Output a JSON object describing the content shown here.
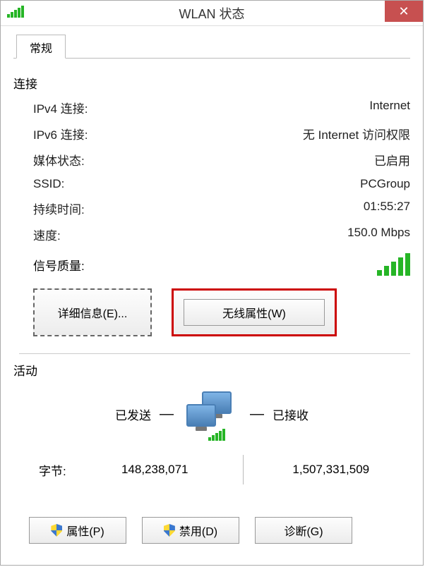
{
  "window": {
    "title": "WLAN 状态"
  },
  "tabs": {
    "general": "常规"
  },
  "connection": {
    "section_label": "连接",
    "ipv4_label": "IPv4 连接:",
    "ipv4_value": "Internet",
    "ipv6_label": "IPv6 连接:",
    "ipv6_value": "无 Internet 访问权限",
    "media_state_label": "媒体状态:",
    "media_state_value": "已启用",
    "ssid_label": "SSID:",
    "ssid_value": "PCGroup",
    "duration_label": "持续时间:",
    "duration_value": "01:55:27",
    "speed_label": "速度:",
    "speed_value": "150.0 Mbps",
    "signal_quality_label": "信号质量:"
  },
  "buttons": {
    "details": "详细信息(E)...",
    "wireless_properties": "无线属性(W)",
    "properties": "属性(P)",
    "disable": "禁用(D)",
    "diagnose": "诊断(G)"
  },
  "activity": {
    "section_label": "活动",
    "sent_label": "已发送",
    "received_label": "已接收",
    "bytes_label": "字节:",
    "bytes_sent": "148,238,071",
    "bytes_received": "1,507,331,509"
  }
}
